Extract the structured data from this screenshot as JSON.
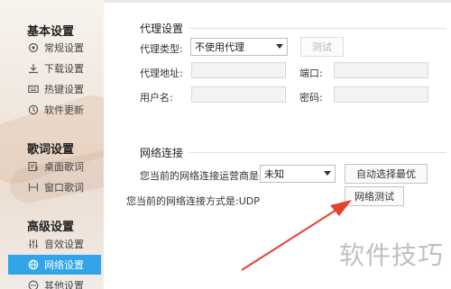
{
  "sidebar": {
    "groups": [
      {
        "title": "基本设置",
        "items": [
          {
            "label": "常规设置",
            "icon": "gear-icon"
          },
          {
            "label": "下载设置",
            "icon": "download-icon"
          },
          {
            "label": "热键设置",
            "icon": "keyboard-icon"
          },
          {
            "label": "软件更新",
            "icon": "update-icon"
          }
        ]
      },
      {
        "title": "歌词设置",
        "items": [
          {
            "label": "桌面歌词",
            "icon": "desktop-lyrics-icon"
          },
          {
            "label": "窗口歌词",
            "icon": "window-lyrics-icon"
          }
        ]
      },
      {
        "title": "高级设置",
        "items": [
          {
            "label": "音效设置",
            "icon": "equalizer-icon"
          },
          {
            "label": "网络设置",
            "icon": "network-icon",
            "active": true
          },
          {
            "label": "其他设置",
            "icon": "more-icon"
          }
        ]
      }
    ],
    "accent_color": "#30a5e8"
  },
  "proxy": {
    "title": "代理设置",
    "type_label": "代理类型:",
    "type_value": "不使用代理",
    "test_button": "测试",
    "address_label": "代理地址:",
    "address_value": "",
    "port_label": "端口:",
    "port_value": "",
    "username_label": "用户名:",
    "username_value": "",
    "password_label": "密码:",
    "password_value": ""
  },
  "network": {
    "title": "网络连接",
    "carrier_label": "您当前的网络连接运营商是:",
    "carrier_value": "未知",
    "auto_select_button": "自动选择最优",
    "mode_text": "您当前的网络连接方式是:UDP",
    "test_button": "网络测试"
  },
  "watermark": "软件技巧",
  "annotation_color": "#e8402f"
}
